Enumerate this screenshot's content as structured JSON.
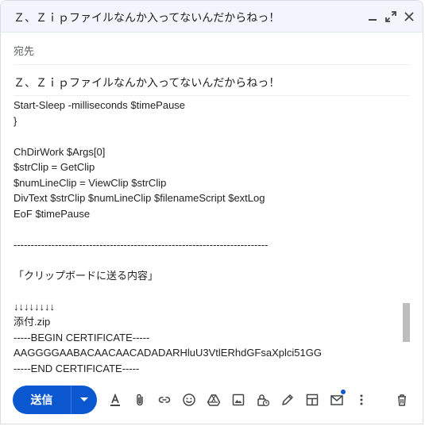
{
  "window": {
    "title": "Ｚ、Ｚｉｐファイルなんか入ってないんだからねっ！"
  },
  "recipients": {
    "label": "宛先",
    "value": ""
  },
  "subject": {
    "text": "Ｚ、Ｚｉｐファイルなんか入ってないんだからねっ！"
  },
  "body": {
    "lines": [
      "  Start-Sleep -milliseconds $timePause",
      "}",
      "",
      "ChDirWork $Args[0]",
      "$strClip = GetClip",
      "$numLineClip = ViewClip $strClip",
      "DivText $strClip $numLineClip $filenameScript $extLog",
      "EoF $timePause",
      "",
      "--------------------------------------------------------------------------",
      "",
      "「クリップボードに送る内容」",
      "",
      "↓↓↓↓↓↓↓↓",
      "添付.zip",
      "-----BEGIN CERTIFICATE-----",
      "AAGGGGAABACAACAACADADARHluU3VtlERhdGFsaXplci51GG",
      "-----END CERTIFICATE-----"
    ]
  },
  "scrollbar": {
    "position": 0.86,
    "visible_fraction": 0.14
  },
  "toolbar": {
    "send_label": "送信",
    "icons": [
      "formatting-icon",
      "attachment-icon",
      "link-icon",
      "emoji-icon",
      "drive-icon",
      "photo-icon",
      "confidential-lock-icon",
      "signature-pen-icon",
      "layouts-icon",
      "schedule-email-icon",
      "more-options-icon"
    ],
    "badge_color": "#0b57d0"
  },
  "colors": {
    "accent": "#0b57d0",
    "titlebar_bg": "#f2f6fc"
  }
}
